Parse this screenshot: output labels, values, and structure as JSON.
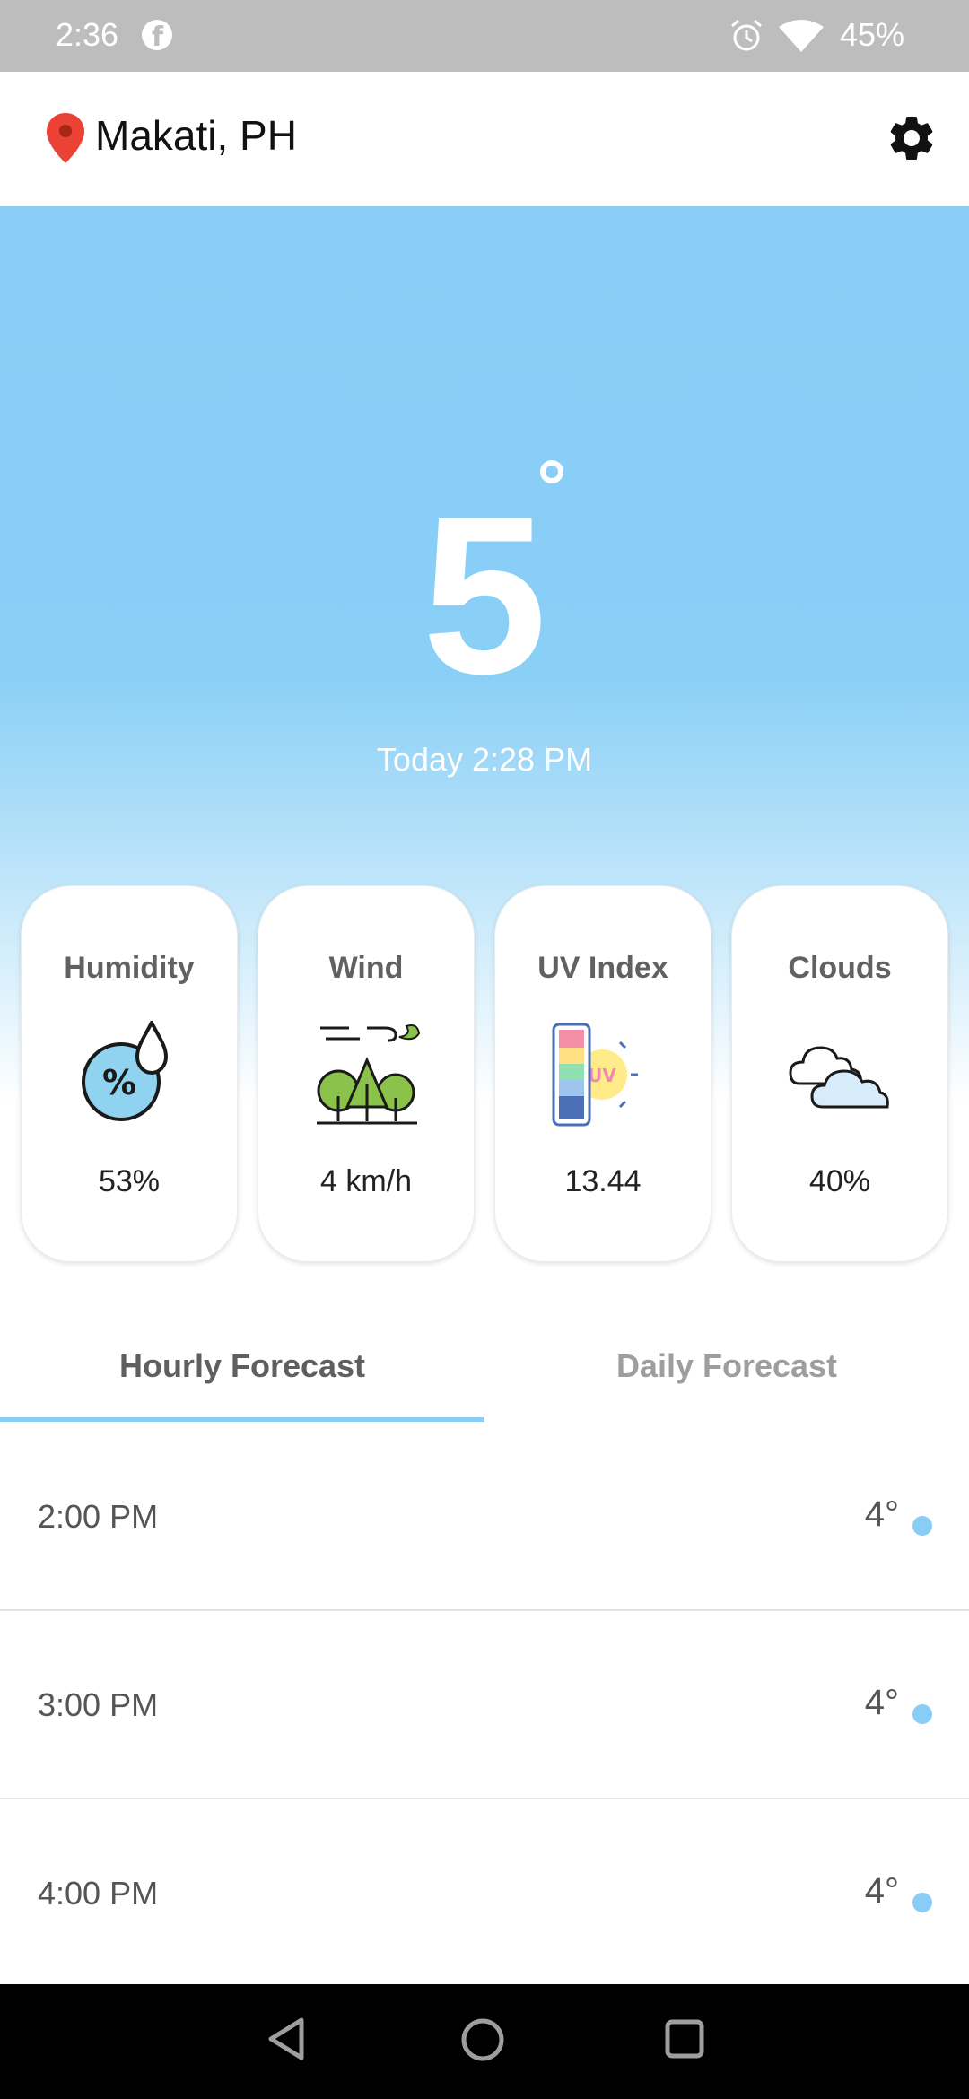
{
  "status_bar": {
    "time": "2:36",
    "facebook_glyph": "f",
    "battery": "45%",
    "icons": [
      "facebook-icon",
      "alarm-icon",
      "wifi-icon"
    ]
  },
  "header": {
    "location": "Makati, PH",
    "icons": [
      "location-pin-icon",
      "gear-icon"
    ]
  },
  "current": {
    "temperature": "5",
    "updated": "Today 2:28 PM"
  },
  "metrics": [
    {
      "title": "Humidity",
      "value": "53%",
      "icon": "humidity-icon"
    },
    {
      "title": "Wind",
      "value": "4 km/h",
      "icon": "wind-icon"
    },
    {
      "title": "UV Index",
      "value": "13.44",
      "icon": "uv-index-icon"
    },
    {
      "title": "Clouds",
      "value": "40%",
      "icon": "clouds-icon"
    }
  ],
  "tabs": [
    {
      "label": "Hourly Forecast",
      "selected": true
    },
    {
      "label": "Daily Forecast",
      "selected": false
    }
  ],
  "hourly": [
    {
      "time": "2:00 PM",
      "temp": "4°"
    },
    {
      "time": "3:00 PM",
      "temp": "4°"
    },
    {
      "time": "4:00 PM",
      "temp": "4°"
    }
  ],
  "colors": {
    "sky": "#89ccf5",
    "pin": "#ea4335",
    "status_bar": "#bdbdbd"
  }
}
